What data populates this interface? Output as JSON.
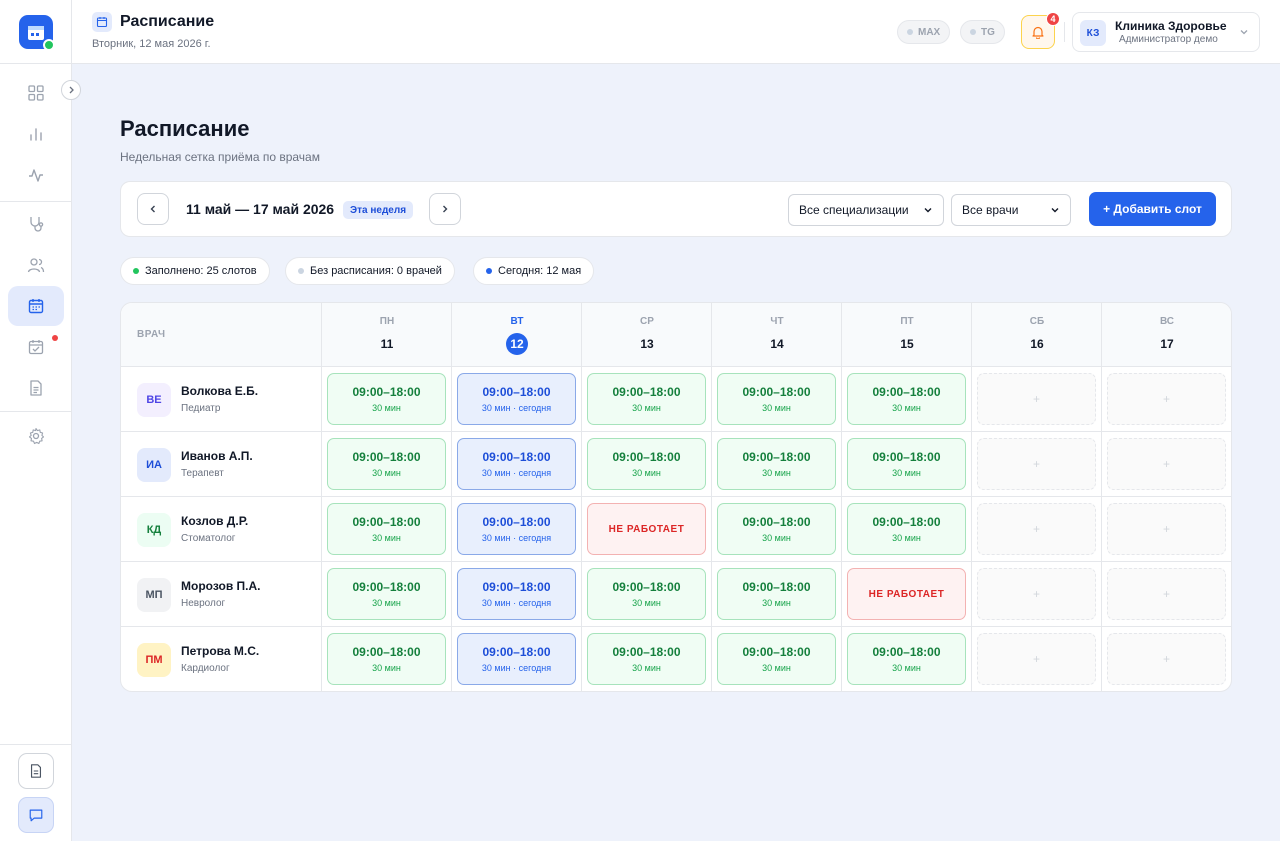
{
  "sidebar": {
    "nav": [
      {
        "icon": "dashboard-grid-icon"
      },
      {
        "icon": "bar-chart-icon"
      },
      {
        "icon": "activity-pulse-icon"
      },
      {
        "icon": "stethoscope-icon"
      },
      {
        "icon": "users-icon"
      },
      {
        "icon": "calendar-icon",
        "active": true
      },
      {
        "icon": "calendar-check-icon",
        "badge": true
      },
      {
        "icon": "document-icon"
      },
      {
        "icon": "settings-gear-icon"
      }
    ],
    "bottom": [
      {
        "icon": "document-icon"
      },
      {
        "icon": "chat-icon"
      }
    ]
  },
  "header": {
    "title": "Расписание",
    "date": "Вторник, 12 мая 2026 г.",
    "channels": [
      "MAX",
      "TG"
    ],
    "notifications_count": "4",
    "account": {
      "initials": "КЗ",
      "name": "Клиника Здоровье",
      "role": "Администратор демо"
    }
  },
  "main": {
    "title": "Расписание",
    "subtitle": "Недельная сетка приёма по врачам",
    "week_range": "11 май — 17 май 2026",
    "this_week_label": "Эта неделя",
    "filters": {
      "specialization": "Все специализации",
      "doctor": "Все врачи"
    },
    "add_slot_label": "+ Добавить слот",
    "stats": [
      {
        "label": "Заполнено: 25 слотов",
        "color": "#22c55e"
      },
      {
        "label": "Без расписания: 0 врачей",
        "color": "#cbd5e1"
      },
      {
        "label": "Сегодня: 12 мая",
        "color": "#2563eb"
      }
    ]
  },
  "grid": {
    "doctor_col_label": "ВРАЧ",
    "days": [
      {
        "dow": "ПН",
        "num": "11"
      },
      {
        "dow": "ВТ",
        "num": "12",
        "today": true
      },
      {
        "dow": "СР",
        "num": "13"
      },
      {
        "dow": "ЧТ",
        "num": "14"
      },
      {
        "dow": "ПТ",
        "num": "15"
      },
      {
        "dow": "СБ",
        "num": "16"
      },
      {
        "dow": "ВС",
        "num": "17"
      }
    ],
    "rows": [
      {
        "initials": "ВЕ",
        "name": "Волкова Е.Б.",
        "spec": "Педиатр",
        "avatar_bg": "#f3effe",
        "avatar_fg": "#4f46e5",
        "cells": [
          {
            "type": "work",
            "time": "09:00–18:00",
            "sub": "30 мин"
          },
          {
            "type": "today",
            "time": "09:00–18:00",
            "sub": "30 мин · сегодня"
          },
          {
            "type": "work",
            "time": "09:00–18:00",
            "sub": "30 мин"
          },
          {
            "type": "work",
            "time": "09:00–18:00",
            "sub": "30 мин"
          },
          {
            "type": "work",
            "time": "09:00–18:00",
            "sub": "30 мин"
          },
          {
            "type": "empty",
            "time": "+"
          },
          {
            "type": "empty",
            "time": "+"
          }
        ]
      },
      {
        "initials": "ИА",
        "name": "Иванов А.П.",
        "spec": "Терапевт",
        "avatar_bg": "#e3eafc",
        "avatar_fg": "#1d4ed8",
        "cells": [
          {
            "type": "work",
            "time": "09:00–18:00",
            "sub": "30 мин"
          },
          {
            "type": "today",
            "time": "09:00–18:00",
            "sub": "30 мин · сегодня"
          },
          {
            "type": "work",
            "time": "09:00–18:00",
            "sub": "30 мин"
          },
          {
            "type": "work",
            "time": "09:00–18:00",
            "sub": "30 мин"
          },
          {
            "type": "work",
            "time": "09:00–18:00",
            "sub": "30 мин"
          },
          {
            "type": "empty",
            "time": "+"
          },
          {
            "type": "empty",
            "time": "+"
          }
        ]
      },
      {
        "initials": "КД",
        "name": "Козлов Д.Р.",
        "spec": "Стоматолог",
        "avatar_bg": "#ecfdf3",
        "avatar_fg": "#15803d",
        "cells": [
          {
            "type": "work",
            "time": "09:00–18:00",
            "sub": "30 мин"
          },
          {
            "type": "today",
            "time": "09:00–18:00",
            "sub": "30 мин · сегодня"
          },
          {
            "type": "off",
            "time": "НЕ РАБОТАЕТ"
          },
          {
            "type": "work",
            "time": "09:00–18:00",
            "sub": "30 мин"
          },
          {
            "type": "work",
            "time": "09:00–18:00",
            "sub": "30 мин"
          },
          {
            "type": "empty",
            "time": "+"
          },
          {
            "type": "empty",
            "time": "+"
          }
        ]
      },
      {
        "initials": "МП",
        "name": "Морозов П.А.",
        "spec": "Невролог",
        "avatar_bg": "#f1f2f4",
        "avatar_fg": "#4b5563",
        "cells": [
          {
            "type": "work",
            "time": "09:00–18:00",
            "sub": "30 мин"
          },
          {
            "type": "today",
            "time": "09:00–18:00",
            "sub": "30 мин · сегодня"
          },
          {
            "type": "work",
            "time": "09:00–18:00",
            "sub": "30 мин"
          },
          {
            "type": "work",
            "time": "09:00–18:00",
            "sub": "30 мин"
          },
          {
            "type": "off",
            "time": "НЕ РАБОТАЕТ"
          },
          {
            "type": "empty",
            "time": "+"
          },
          {
            "type": "empty",
            "time": "+"
          }
        ]
      },
      {
        "initials": "ПМ",
        "name": "Петрова М.С.",
        "spec": "Кардиолог",
        "avatar_bg": "#fff3c4",
        "avatar_fg": "#dc2626",
        "cells": [
          {
            "type": "work",
            "time": "09:00–18:00",
            "sub": "30 мин"
          },
          {
            "type": "today",
            "time": "09:00–18:00",
            "sub": "30 мин · сегодня"
          },
          {
            "type": "work",
            "time": "09:00–18:00",
            "sub": "30 мин"
          },
          {
            "type": "work",
            "time": "09:00–18:00",
            "sub": "30 мин"
          },
          {
            "type": "work",
            "time": "09:00–18:00",
            "sub": "30 мин"
          },
          {
            "type": "empty",
            "time": "+"
          },
          {
            "type": "empty",
            "time": "+"
          }
        ]
      }
    ]
  }
}
